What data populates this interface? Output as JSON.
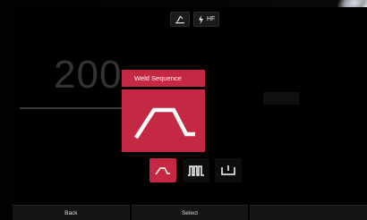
{
  "status_bar": {
    "items": [
      {
        "icon": "torch-icon",
        "label": ""
      },
      {
        "icon": "lightning-icon",
        "label": "HF"
      }
    ]
  },
  "background": {
    "value": "200"
  },
  "popup": {
    "title": "Weld Sequence",
    "selected_icon": "weld-sequence-ramp-icon"
  },
  "options": [
    {
      "icon": "ramp-icon",
      "selected": true
    },
    {
      "icon": "pulse-icon",
      "selected": false
    },
    {
      "icon": "spot-icon",
      "selected": false
    }
  ],
  "softkeys": [
    {
      "label": "Back"
    },
    {
      "label": "Select"
    },
    {
      "label": ""
    }
  ],
  "colors": {
    "accent": "#c42843",
    "screen_bg": "#000000",
    "dim_text": "#3c3c3c"
  }
}
